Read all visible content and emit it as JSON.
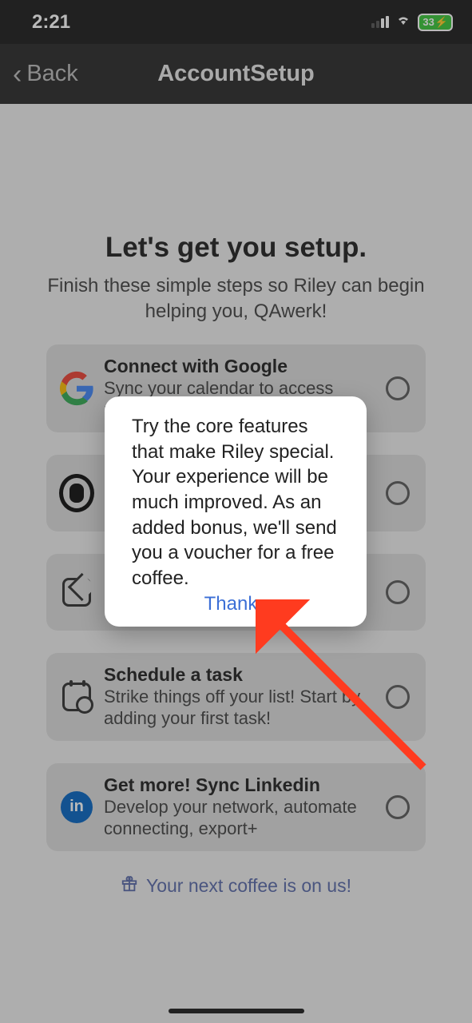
{
  "status": {
    "time": "2:21",
    "battery": "33",
    "battery_charging": "⚡"
  },
  "nav": {
    "back": "Back",
    "title": "AccountSetup"
  },
  "page": {
    "headline": "Let's get you setup.",
    "subhead": "Finish these simple steps so Riley can begin helping you, QAwerk!"
  },
  "cards": [
    {
      "title": "Connect with Google",
      "desc": "Sync your calendar to access meetings, events"
    },
    {
      "title": "",
      "desc": ""
    },
    {
      "title": "",
      "desc": ""
    },
    {
      "title": "Schedule a task",
      "desc": "Strike things off your list! Start by adding your first task!"
    },
    {
      "title": "Get more! Sync Linkedin",
      "desc": "Develop your network, automate connecting, export+"
    }
  ],
  "footer": {
    "label": "Your next coffee is on us!"
  },
  "popup": {
    "body": "Try the core features that make Riley special. Your experience will be much improved. As an added bonus, we'll send you a voucher for a free coffee.",
    "button": "Thanks"
  },
  "linkedin_glyph": "in"
}
